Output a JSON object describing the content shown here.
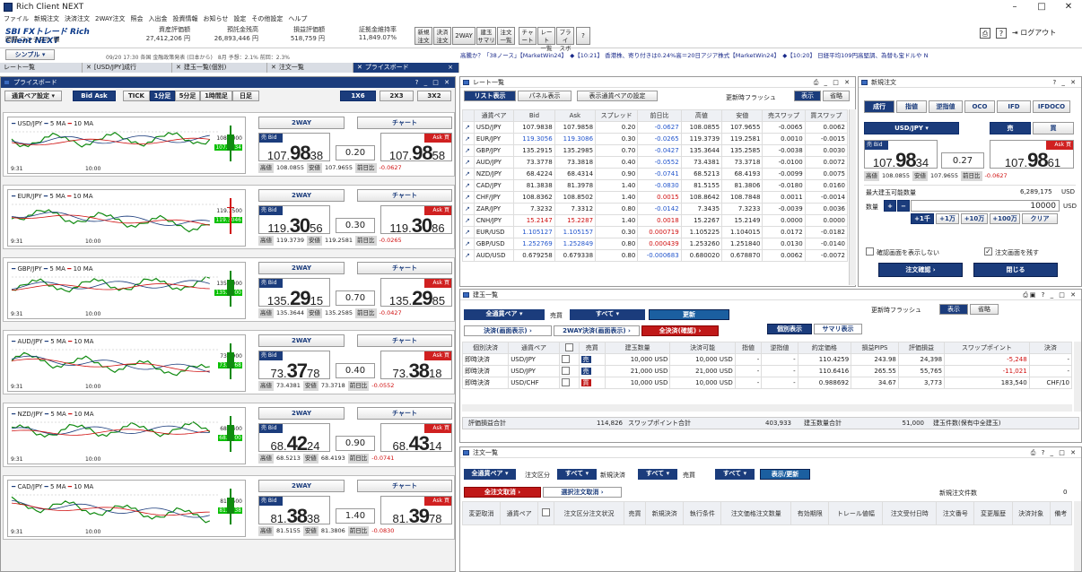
{
  "window": {
    "title": "Rich Client NEXT",
    "controls": [
      "–",
      "□",
      "✕"
    ]
  },
  "menu": [
    "ファイル",
    "新規注文",
    "決済注文",
    "2WAY注文",
    "照会",
    "入出金",
    "投資情報",
    "お知らせ",
    "設定",
    "その他設定",
    "ヘルプ"
  ],
  "toolbar": {
    "logo": "SBI FXトレード  Rich Client NEXT",
    "account": "岡野 コンテスト 様",
    "stats": [
      {
        "label": "資産評価額",
        "value": "27,412,206 円"
      },
      {
        "label": "預託金残高",
        "value": "26,893,446 円"
      },
      {
        "label": "損益評価額",
        "value": "518,759 円"
      },
      {
        "label": "証拠金維持率",
        "value": "11,849.07%"
      }
    ],
    "buttons": [
      {
        "l1": "新規",
        "l2": "注文"
      },
      {
        "l1": "決済",
        "l2": "注文"
      },
      {
        "l1": "2WAY",
        "l2": ""
      },
      {
        "l1": "建玉",
        "l2": "サマリ"
      },
      {
        "l1": "注文",
        "l2": "一覧"
      },
      {
        "l1": "チャ",
        "l2": "ート"
      },
      {
        "l1": "レート",
        "l2": "一覧"
      },
      {
        "l1": "プライ",
        "l2": "スボ"
      },
      {
        "l1": "?",
        "l2": ""
      }
    ],
    "logout": "ログアウト",
    "simple": "シンプル"
  },
  "ticker": "高騰か？「38ノース」【MarketWin24】　◆【10:21】 香港株、寄り付きは0.24%高＝20日アジア株式【MarketWin24】　◆【10:20】 日経平均109円高堅調、為替も宝ドルや N",
  "marquee_left": "09/20 17:30 各国 金融政策発表 (日本から)　8月 予想：2.1% 前回：2.3%",
  "tabs": [
    {
      "label": "レート一覧",
      "active": false
    },
    {
      "label": "[USD/JPY]成行",
      "active": false
    },
    {
      "label": "建玉一覧(個別)",
      "active": false
    },
    {
      "label": "注文一覧",
      "active": false
    },
    {
      "label": "プライスボード",
      "active": true
    }
  ],
  "priceboard": {
    "title": "プライスボード",
    "controls": "? _ □ ✕",
    "toolbar": {
      "display": "通貨ペア設定",
      "bidask": "Bid Ask",
      "tick": "TICK",
      "periods": [
        "1分足",
        "5分足",
        "1時間足",
        "日足"
      ],
      "active_period": "1分足",
      "layouts": [
        "1X6",
        "2X3",
        "3X2"
      ]
    },
    "common": {
      "twoway": "2WAY",
      "chart": "チャート",
      "bid": "売 Bid",
      "ask": "Ask 買",
      "high": "高値",
      "low": "安値",
      "prev": "前日比",
      "time1": "9:31",
      "time2": "10:00"
    },
    "rows": [
      {
        "pair": "USD/JPY",
        "ma5": "5 MA",
        "ma10": "10 MA",
        "axis1": "108.0000",
        "last": "107.9834",
        "bid_small": "107.",
        "bid_big": "98",
        "bid_tail": "38",
        "ask_small": "107.",
        "ask_big": "98",
        "ask_tail": "58",
        "spread": "0.20",
        "high": "108.0855",
        "low": "107.9655",
        "change": "-0.0627"
      },
      {
        "pair": "EUR/JPY",
        "ma5": "5 MA",
        "ma10": "10 MA",
        "axis1": "119.3500",
        "last": "119.3046",
        "bid_small": "119.",
        "bid_big": "30",
        "bid_tail": "56",
        "ask_small": "119.",
        "ask_big": "30",
        "ask_tail": "86",
        "spread": "0.30",
        "high": "119.3739",
        "low": "119.2581",
        "change": "-0.0265"
      },
      {
        "pair": "GBP/JPY",
        "ma5": "5 MA",
        "ma10": "10 MA",
        "axis1": "135.3000",
        "last": "135.2900",
        "bid_small": "135.",
        "bid_big": "29",
        "bid_tail": "15",
        "ask_small": "135.",
        "ask_big": "29",
        "ask_tail": "85",
        "spread": "0.70",
        "high": "135.3644",
        "low": "135.2585",
        "change": "-0.0427"
      },
      {
        "pair": "AUD/JPY",
        "ma5": "5 MA",
        "ma10": "10 MA",
        "axis1": "73.3900",
        "last": "73.3768",
        "bid_small": "73.",
        "bid_big": "37",
        "bid_tail": "78",
        "ask_small": "73.",
        "ask_big": "38",
        "ask_tail": "18",
        "spread": "0.40",
        "high": "73.4381",
        "low": "73.3718",
        "change": "-0.0552"
      },
      {
        "pair": "NZD/JPY",
        "ma5": "5 MA",
        "ma10": "10 MA",
        "axis1": "68.4400",
        "last": "68.4200",
        "bid_small": "68.",
        "bid_big": "42",
        "bid_tail": "24",
        "ask_small": "68.",
        "ask_big": "43",
        "ask_tail": "14",
        "spread": "0.90",
        "high": "68.5213",
        "low": "68.4193",
        "change": "-0.0741"
      },
      {
        "pair": "CAD/JPY",
        "ma5": "5 MA",
        "ma10": "10 MA",
        "axis1": "81.4500",
        "last": "81.3838",
        "bid_small": "81.",
        "bid_big": "38",
        "bid_tail": "38",
        "ask_small": "81.",
        "ask_big": "39",
        "ask_tail": "78",
        "spread": "1.40",
        "high": "81.5155",
        "low": "81.3806",
        "change": "-0.0830"
      }
    ]
  },
  "ratelist": {
    "title": "レート一覧",
    "tabs": [
      "リスト表示",
      "パネル表示",
      "表示通貨ペアの設定"
    ],
    "flash_label": "更新時フラッシュ",
    "show": "表示",
    "hide": "省略",
    "headers": [
      "通貨ペア",
      "Bid",
      "Ask",
      "スプレッド",
      "前日比",
      "高値",
      "安値",
      "売スワップ",
      "買スワップ"
    ],
    "rows": [
      [
        "USD/JPY",
        "107.9838",
        "107.9858",
        "0.20",
        "-0.0627",
        "108.0855",
        "107.9655",
        "-0.0065",
        "0.0062"
      ],
      [
        "EUR/JPY",
        "119.3056",
        "119.3086",
        "0.30",
        "-0.0265",
        "119.3739",
        "119.2581",
        "0.0010",
        "-0.0015"
      ],
      [
        "GBP/JPY",
        "135.2915",
        "135.2985",
        "0.70",
        "-0.0427",
        "135.3644",
        "135.2585",
        "-0.0038",
        "0.0030"
      ],
      [
        "AUD/JPY",
        "73.3778",
        "73.3818",
        "0.40",
        "-0.0552",
        "73.4381",
        "73.3718",
        "-0.0100",
        "0.0072"
      ],
      [
        "NZD/JPY",
        "68.4224",
        "68.4314",
        "0.90",
        "-0.0741",
        "68.5213",
        "68.4193",
        "-0.0099",
        "0.0075"
      ],
      [
        "CAD/JPY",
        "81.3838",
        "81.3978",
        "1.40",
        "-0.0830",
        "81.5155",
        "81.3806",
        "-0.0180",
        "0.0160"
      ],
      [
        "CHF/JPY",
        "108.8362",
        "108.8502",
        "1.40",
        "0.0015",
        "108.8642",
        "108.7848",
        "0.0011",
        "-0.0014"
      ],
      [
        "ZAR/JPY",
        "7.3232",
        "7.3312",
        "0.80",
        "-0.0142",
        "7.3435",
        "7.3233",
        "-0.0039",
        "0.0036"
      ],
      [
        "CNH/JPY",
        "15.2147",
        "15.2287",
        "1.40",
        "0.0018",
        "15.2267",
        "15.2149",
        "0.0000",
        "0.0000"
      ],
      [
        "EUR/USD",
        "1.105127",
        "1.105157",
        "0.30",
        "0.000719",
        "1.105225",
        "1.104015",
        "0.0172",
        "-0.0182"
      ],
      [
        "GBP/USD",
        "1.252769",
        "1.252849",
        "0.80",
        "0.000439",
        "1.253260",
        "1.251840",
        "0.0130",
        "-0.0140"
      ],
      [
        "AUD/USD",
        "0.679258",
        "0.679338",
        "0.80",
        "-0.000683",
        "0.680020",
        "0.678870",
        "0.0062",
        "-0.0072"
      ]
    ]
  },
  "neworder": {
    "title": "新規注文",
    "tabs": [
      "成行",
      "指値",
      "逆指値",
      "OCO",
      "IFD",
      "IFDOCO"
    ],
    "pair": "USD/JPY",
    "sell": "売",
    "buy": "買",
    "bid": "売 Bid",
    "ask": "Ask 買",
    "bid_small": "107.",
    "bid_big": "98",
    "bid_tail": "34",
    "ask_small": "107.",
    "ask_big": "98",
    "ask_tail": "61",
    "spread": "0.27",
    "high": "108.0855",
    "low": "107.9655",
    "change": "-0.0627",
    "max_label": "最大建玉可能数量",
    "max_value": "6,289,175",
    "max_unit": "USD",
    "qty_label": "数量",
    "qty_value": "10000",
    "qty_unit": "USD",
    "qty_buttons": [
      "+1千",
      "+1万",
      "+10万",
      "+100万",
      "クリア"
    ],
    "confirm_label": "確認画面を表示しない",
    "keep_label": "注文画面を残す",
    "confirm_btn": "注文確認",
    "close_btn": "閉じる"
  },
  "positions": {
    "title": "建玉一覧",
    "pair_btn": "全通貨ペア",
    "sell_buy": "売買",
    "all": "すべて",
    "refresh": "更新",
    "settle1": "決済(画面表示)",
    "settle2": "2WAY決済(画面表示)",
    "settle3": "全決済(確認)",
    "flash_label": "更新時フラッシュ",
    "show": "表示",
    "hide": "省略",
    "view_tabs": [
      "個別表示",
      "サマリ表示"
    ],
    "headers": [
      "個別決済",
      "通貨ペア",
      "",
      "売買",
      "建玉数量",
      "決済可能",
      "指値",
      "逆指値",
      "約定価格",
      "損益PIPS",
      "評価損益",
      "スワップポイント",
      "決済"
    ],
    "rows": [
      [
        "即時決済",
        "USD/JPY",
        "売",
        "10,000 USD",
        "10,000 USD",
        "-",
        "-",
        "110.4259",
        "243.98",
        "24,398",
        "-5,248",
        "-"
      ],
      [
        "即時決済",
        "USD/JPY",
        "売",
        "21,000 USD",
        "21,000 USD",
        "-",
        "-",
        "110.6416",
        "265.55",
        "55,765",
        "-11,021",
        "-"
      ],
      [
        "即時決済",
        "USD/CHF",
        "買",
        "10,000 USD",
        "10,000 USD",
        "-",
        "-",
        "0.988692",
        "34.67",
        "3,773",
        "183,540",
        "CHF/10"
      ]
    ],
    "summary": {
      "pl_label": "評価損益合計",
      "pl_value": "114,826",
      "swap_label": "スワップポイント合計",
      "swap_value": "403,933",
      "qty_label": "建玉数量合計",
      "qty_value": "51,000",
      "margin_label": "建玉件数(保有中全建玉)"
    }
  },
  "orders": {
    "title": "注文一覧",
    "pair_btn": "全通貨ペア",
    "type_label": "注文区分",
    "all": "すべて",
    "new_settle_label": "新規決済",
    "buysell_label": "売買",
    "show_refresh": "表示/更新",
    "cancel_all": "全注文取消",
    "cancel_sel": "選択注文取消",
    "count_label": "新規注文件数",
    "count_value": "0",
    "headers": [
      "変更取消",
      "通貨ペア",
      "",
      "注文区分注文状況",
      "売買",
      "新規決済",
      "執行条件",
      "注文価格注文数量",
      "有効期限",
      "トレール値幅",
      "注文受付日時",
      "注文番号",
      "変更履歴",
      "決済対象",
      "備考"
    ]
  }
}
